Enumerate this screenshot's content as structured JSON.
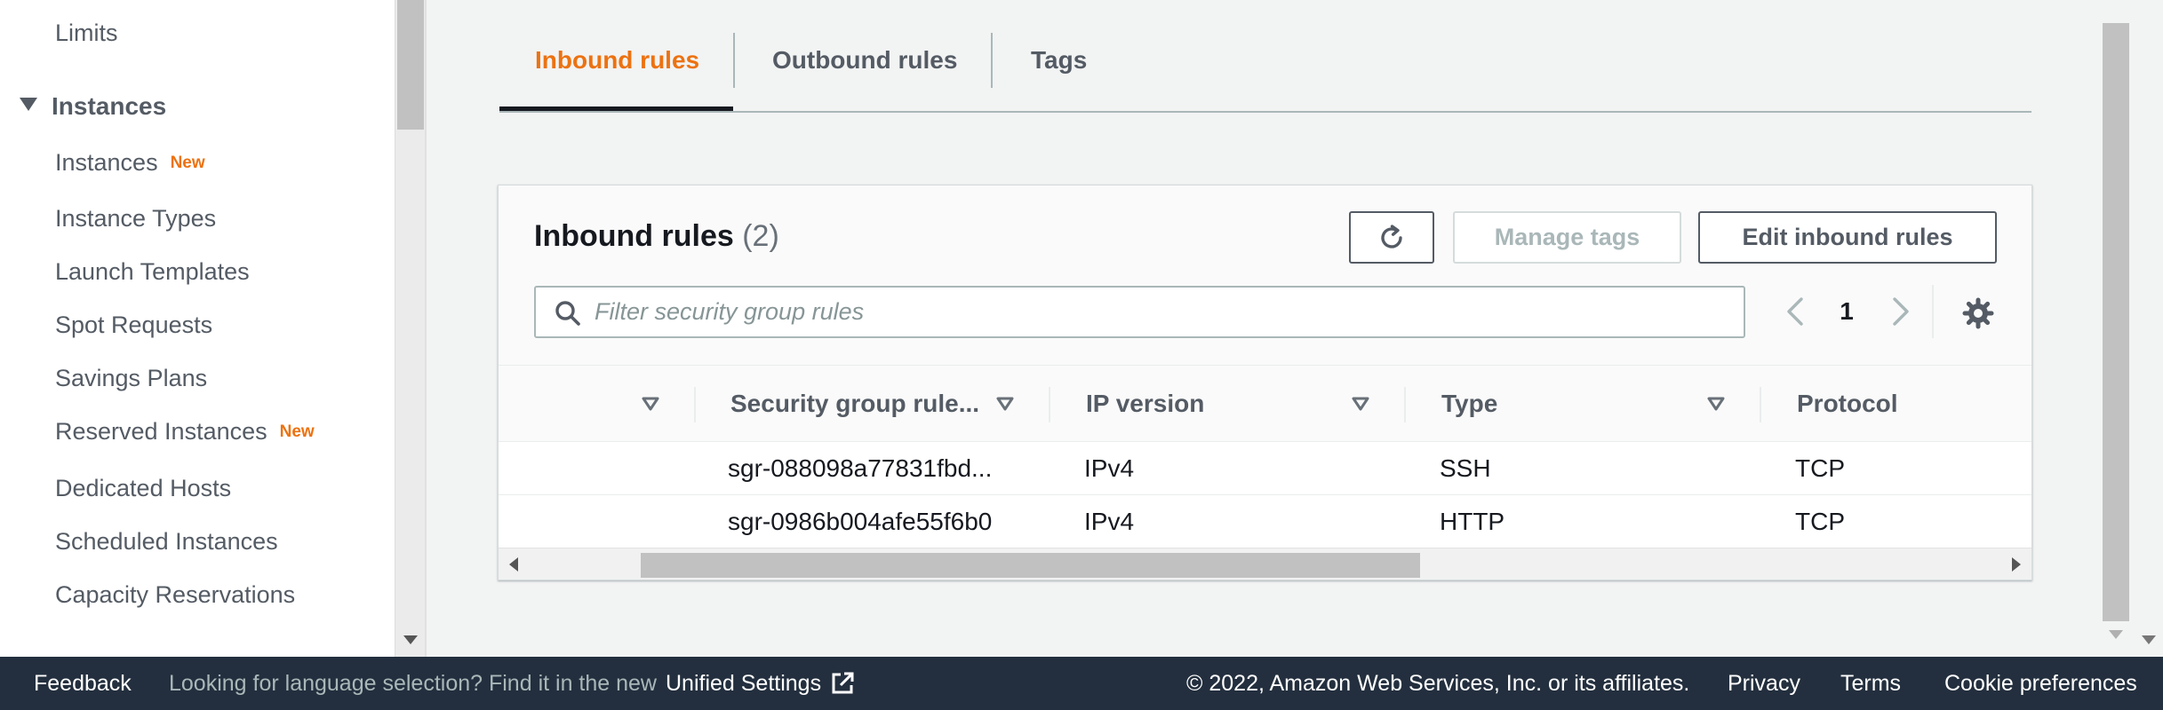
{
  "sidebar": {
    "limits_label": "Limits",
    "section_label": "Instances",
    "items": [
      {
        "label": "Instances",
        "badge": "New"
      },
      {
        "label": "Instance Types",
        "badge": ""
      },
      {
        "label": "Launch Templates",
        "badge": ""
      },
      {
        "label": "Spot Requests",
        "badge": ""
      },
      {
        "label": "Savings Plans",
        "badge": ""
      },
      {
        "label": "Reserved Instances",
        "badge": "New"
      },
      {
        "label": "Dedicated Hosts",
        "badge": ""
      },
      {
        "label": "Scheduled Instances",
        "badge": ""
      },
      {
        "label": "Capacity Reservations",
        "badge": ""
      }
    ]
  },
  "tabs": [
    {
      "label": "Inbound rules",
      "active": true
    },
    {
      "label": "Outbound rules",
      "active": false
    },
    {
      "label": "Tags",
      "active": false
    }
  ],
  "panel": {
    "title": "Inbound rules",
    "count": "(2)",
    "refresh_icon": "refresh-icon",
    "manage_tags_label": "Manage tags",
    "edit_rules_label": "Edit inbound rules",
    "filter_placeholder": "Filter security group rules",
    "page": "1"
  },
  "table": {
    "columns": [
      "",
      "Security group rule...",
      "IP version",
      "Type",
      "Protocol"
    ],
    "rows": [
      [
        "",
        "sgr-088098a77831fbd...",
        "IPv4",
        "SSH",
        "TCP"
      ],
      [
        "",
        "sgr-0986b004afe55f6b0",
        "IPv4",
        "HTTP",
        "TCP"
      ]
    ]
  },
  "footer": {
    "feedback": "Feedback",
    "language_text": "Looking for language selection? Find it in the new",
    "unified_settings": "Unified Settings",
    "copyright": "© 2022, Amazon Web Services, Inc. or its affiliates.",
    "privacy": "Privacy",
    "terms": "Terms",
    "cookie_preferences": "Cookie preferences"
  },
  "colors": {
    "accent": "#ec7211",
    "footer_bg": "#232f3e",
    "text": "#16191f",
    "muted": "#545b64"
  }
}
